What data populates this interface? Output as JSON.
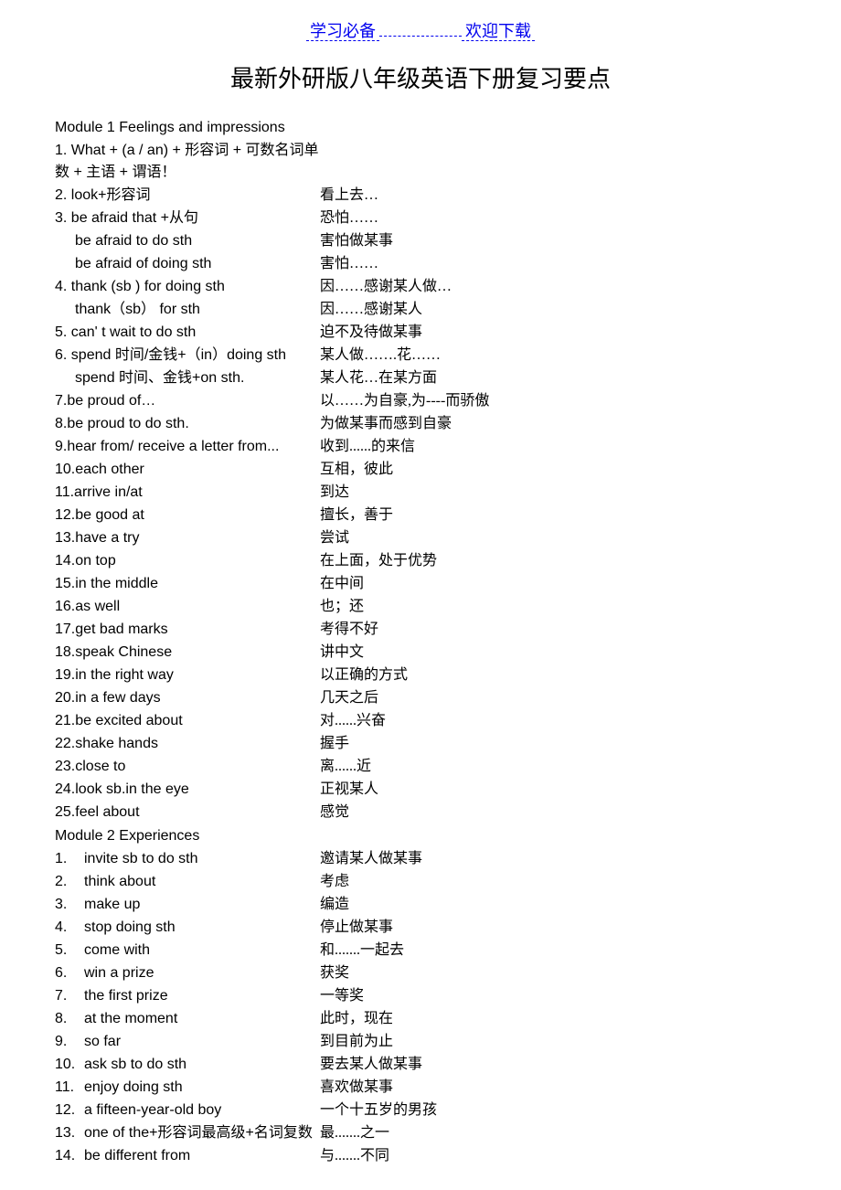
{
  "header": {
    "link1": "学习必备",
    "link2": "欢迎下载"
  },
  "title": "最新外研版八年级英语下册复习要点",
  "module1": {
    "header": "Module  1  Feelings and impressions",
    "items": [
      {
        "l": "1. What + (a / an) + 形容词 + 可数名词单数 + 主语 + 谓语！",
        "r": ""
      },
      {
        "l": "2. look+形容词",
        "r": "看上去…"
      },
      {
        "l": "3. be afraid that +从句",
        "r": "恐怕……"
      },
      {
        "l": "be afraid to do sth",
        "r": "害怕做某事",
        "indent": true
      },
      {
        "l": "be afraid of doing sth",
        "r": "害怕……",
        "indent": true
      },
      {
        "l": "4. thank (sb ) for doing sth",
        "r": "因……感谢某人做…"
      },
      {
        "l": "thank（sb） for sth",
        "r": "因……感谢某人",
        "indent": true
      },
      {
        "l": "5. can' t wait to do sth",
        "r": "迫不及待做某事"
      },
      {
        "l": "6. spend  时间/金钱+（in）doing sth",
        "r": "某人做…….花……"
      },
      {
        "l": "spend  时间、金钱+on sth.",
        "r": "某人花…在某方面",
        "indent": true
      },
      {
        "l": "7.be proud of…",
        "r": "以……为自豪,为----而骄傲"
      },
      {
        "l": "8.be proud to do sth.",
        "r": "为做某事而感到自豪"
      },
      {
        "l": "9.hear from/ receive a letter from...",
        "r": "收到......的来信"
      },
      {
        "l": "10.each other",
        "r": "互相，彼此"
      },
      {
        "l": "11.arrive in/at",
        "r": "到达"
      },
      {
        "l": "12.be good at",
        "r": "擅长，善于"
      },
      {
        "l": "13.have a try",
        "r": "尝试"
      },
      {
        "l": "14.on top",
        "r": "在上面，处于优势"
      },
      {
        "l": "15.in the middle",
        "r": " 在中间"
      },
      {
        "l": "16.as well",
        "r": "也；还"
      },
      {
        "l": "17.get bad marks",
        "r": "考得不好"
      },
      {
        "l": "18.speak Chinese",
        "r": "讲中文"
      },
      {
        "l": "19.in the right way",
        "r": "以正确的方式"
      },
      {
        "l": "20.in a few days",
        "r": "几天之后"
      },
      {
        "l": "21.be excited about",
        "r": "对......兴奋"
      },
      {
        "l": "22.shake hands",
        "r": "握手"
      },
      {
        "l": "23.close to",
        "r": "离......近"
      },
      {
        "l": "24.look sb.in the eye",
        "r": "正视某人"
      },
      {
        "l": "25.feel about",
        "r": "感觉"
      }
    ]
  },
  "module2": {
    "header": "Module  2  Experiences",
    "items": [
      {
        "n": "1.",
        "l": "invite sb to do sth",
        "r": "邀请某人做某事"
      },
      {
        "n": "2.",
        "l": "think about",
        "r": "考虑"
      },
      {
        "n": "3.",
        "l": "make up",
        "r": "编造"
      },
      {
        "n": "4.",
        "l": "stop doing sth",
        "r": "停止做某事"
      },
      {
        "n": "5.",
        "l": "come with",
        "r": "和.......一起去"
      },
      {
        "n": "6.",
        "l": "  win a prize",
        "r": "获奖"
      },
      {
        "n": "7.",
        "l": "the first prize",
        "r": "一等奖"
      },
      {
        "n": "8.",
        "l": "at the moment",
        "r": "此时，现在"
      },
      {
        "n": "9.",
        "l": "so far",
        "r": "到目前为止"
      },
      {
        "n": "10.",
        "l": "ask sb to do sth",
        "r": "要去某人做某事"
      },
      {
        "n": "11.",
        "l": "enjoy doing sth",
        "r": "喜欢做某事"
      },
      {
        "n": "12.",
        "l": "a fifteen-year-old boy",
        "r": "一个十五岁的男孩"
      },
      {
        "n": "13.",
        "l": "one of the+形容词最高级+名词复数",
        "r": "最.......之一"
      },
      {
        "n": "14.",
        "l": "be different from",
        "r": "与.......不同"
      }
    ]
  }
}
